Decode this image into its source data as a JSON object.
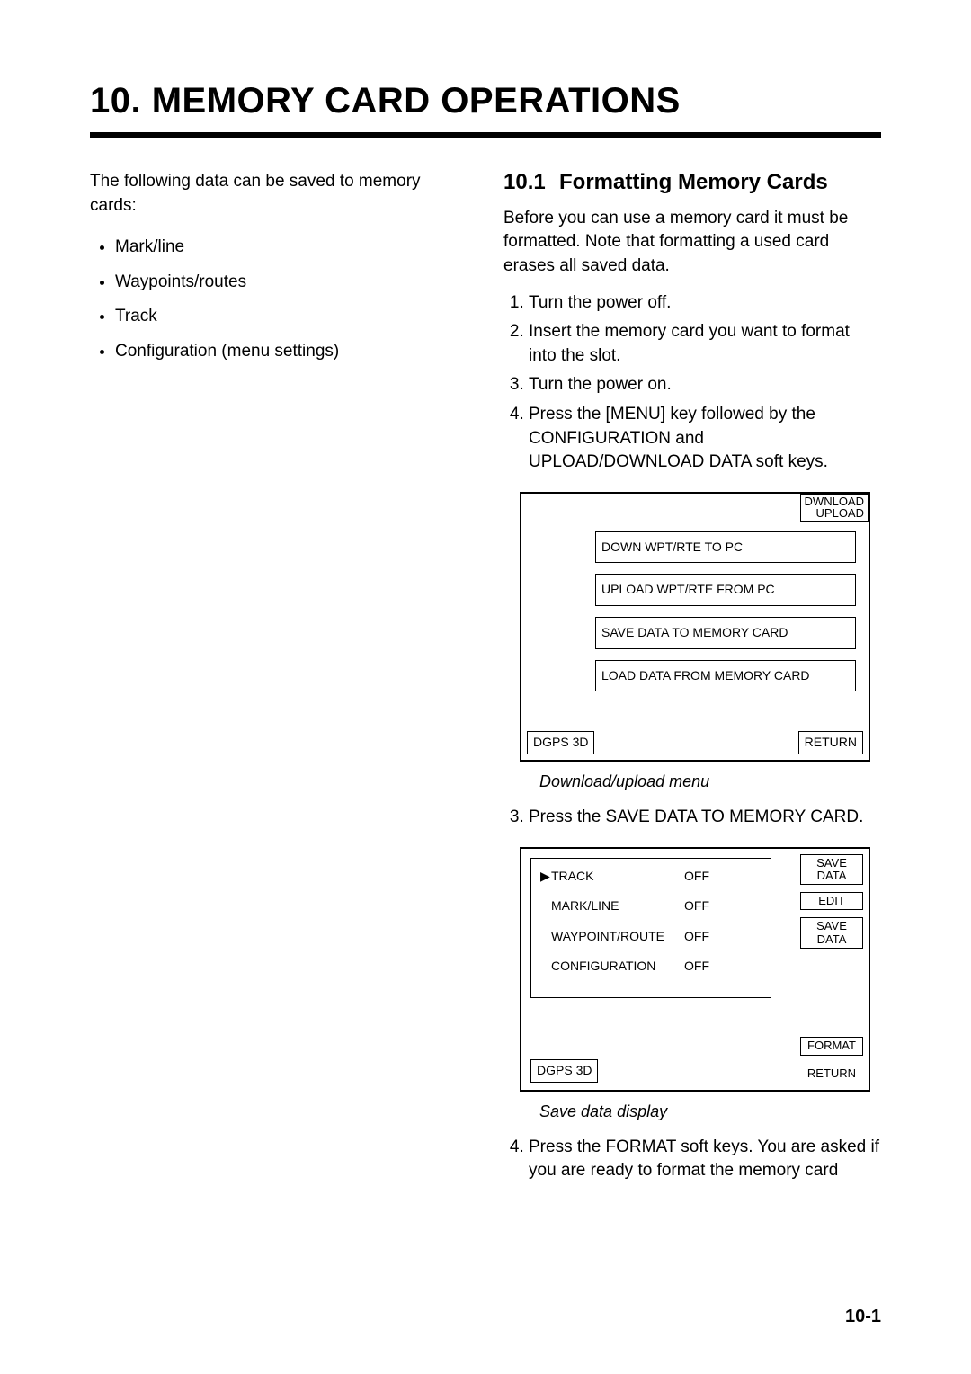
{
  "chapter_title": "10. MEMORY CARD OPERATIONS",
  "left": {
    "intro": "The following data can be saved to memory cards:",
    "bullets": [
      "Mark/line",
      "Waypoints/routes",
      "Track",
      "Configuration (menu settings)"
    ]
  },
  "section": {
    "number": "10.1",
    "name": "Formatting Memory Cards",
    "para": "Before you can use a memory card it must be formatted. Note that formatting a used card erases all saved data.",
    "steps_a": [
      "Turn the power off.",
      "Insert the memory card you want to format into the slot.",
      "Turn the power on.",
      "Press the [MENU] key followed by the CONFIGURATION and UPLOAD/DOWNLOAD DATA soft keys."
    ],
    "fig1": {
      "tab_line1": "DWNLOAD",
      "tab_line2": "UPLOAD",
      "opts": [
        "DOWN WPT/RTE TO PC",
        "UPLOAD WPT/RTE FROM PC",
        "SAVE DATA TO MEMORY CARD",
        "LOAD DATA FROM MEMORY CARD"
      ],
      "dgps": "DGPS 3D",
      "return": "RETURN",
      "caption": "Download/upload menu"
    },
    "steps_b_start": 3,
    "steps_b": [
      "Press the SAVE DATA TO MEMORY CARD."
    ],
    "fig2": {
      "rows": [
        {
          "k": "TRACK",
          "v": "OFF",
          "caret": true
        },
        {
          "k": "MARK/LINE",
          "v": "OFF",
          "caret": false
        },
        {
          "k": "WAYPOINT/ROUTE",
          "v": "OFF",
          "caret": false
        },
        {
          "k": "CONFIGURATION",
          "v": "OFF",
          "caret": false
        }
      ],
      "side": [
        {
          "l1": "SAVE",
          "l2": "DATA",
          "shadow": false
        },
        {
          "l1": "EDIT",
          "l2": "",
          "shadow": true
        },
        {
          "l1": "SAVE",
          "l2": "DATA",
          "shadow": true
        }
      ],
      "format": "FORMAT",
      "return": "RETURN",
      "dgps": "DGPS 3D",
      "caption": "Save data display"
    },
    "steps_c_start": 4,
    "steps_c": [
      "Press the FORMAT soft keys. You are asked if you are ready to format the memory card"
    ]
  },
  "page_number": "10-1"
}
